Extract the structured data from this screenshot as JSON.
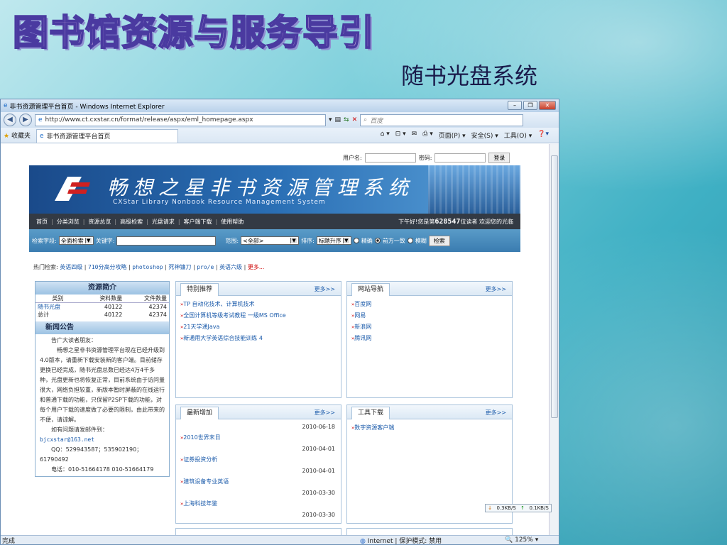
{
  "slide": {
    "title": "图书馆资源与服务导引",
    "subtitle": "随书光盘系统"
  },
  "browser": {
    "window_title": "非书资源管理平台首页 - Windows Internet Explorer",
    "url": "http://www.ct.cxstar.cn/format/release/aspx/eml_homepage.aspx",
    "search_placeholder": "百度",
    "favorites_label": "收藏夹",
    "tab_title": "非书资源管理平台首页",
    "tools": {
      "page": "页面(P) ▾",
      "safety": "安全(S) ▾",
      "tools": "工具(O) ▾"
    },
    "status_left": "完成",
    "status_zone": "Internet | 保护模式: 禁用",
    "zoom": "125%"
  },
  "page": {
    "login": {
      "user_label": "用户名:",
      "pass_label": "密码:",
      "button": "登录"
    },
    "banner": {
      "cn": "畅想之星非书资源管理系统",
      "en": "CXStar Library Nonbook Resource Management System"
    },
    "nav": [
      "首页",
      "分类浏览",
      "资源总览",
      "高级检索",
      "光盘请求",
      "客户端下载",
      "使用帮助"
    ],
    "greeting": {
      "prefix": "下午好!您是第",
      "count": "628547",
      "suffix": "位读者  欢迎您的光临"
    },
    "search": {
      "field_label": "检索字段:",
      "field_value": "全面检索",
      "keyword_label": "关键字:",
      "scope_label": "范围:",
      "scope_value": "<全部>",
      "sort_label": "排序:",
      "sort_value": "标题升序",
      "modes": [
        "精确",
        "前方一致",
        "模糊"
      ],
      "button": "检索"
    },
    "hot": {
      "label": "热门检索:",
      "items": [
        "英语四级",
        "710分高分攻略",
        "photoshop",
        "死神镰刀",
        "pro/e",
        "英语六级"
      ],
      "more": "更多..."
    },
    "resources": {
      "title": "资源简介",
      "headers": [
        "类别",
        "资料数量",
        "文件数量"
      ],
      "rows": [
        [
          "随书光盘",
          "40122",
          "42374"
        ],
        [
          "总计",
          "40122",
          "42374"
        ]
      ]
    },
    "news": {
      "title": "新闻公告",
      "greeting": "告广大读者朋友：",
      "body": "畅想之星非书资源管理平台现在已经升级到4.0版本，请重新下载安装新的客户端。目前储存更换已经完成，随书光盘总数已经达4万4千多种，光盘更新也将恢复正常，目前系统由于访问量很大，网络负担较重，新版本暂时屏蔽的在线运行和普通下载的功能，只保留P2SP下载的功能，对每个用户下载的速度做了必要的限制，由此带来的不便，请谅解。",
      "contact": "如有问题请发邮件到：",
      "email": "bjcxstar@163.net",
      "qq": "QQ：529943587；535902190；61790492",
      "phone": "电话：010-51664178   010-51664179"
    },
    "boxes": {
      "featured": {
        "title": "特别推荐",
        "more": "更多>>",
        "items": [
          "TP 自动化技术、计算机技术",
          "全国计算机等级考试教程 一级MS Office",
          "21天学通Java",
          "新通用大学英语综合技能训练 4"
        ]
      },
      "sites": {
        "title": "网站导航",
        "more": "更多>>",
        "items": [
          "百度网",
          "网易",
          "新浪网",
          "腾讯网"
        ]
      },
      "latest": {
        "title": "最新增加",
        "more": "更多>>",
        "items": [
          {
            "date": "2010-06-18",
            "t": "2010世界末日"
          },
          {
            "date": "2010-04-01",
            "t": "证券投资分析"
          },
          {
            "date": "2010-04-01",
            "t": "建筑设备专业英语"
          },
          {
            "date": "2010-03-30",
            "t": "上海科技年鉴"
          }
        ],
        "last_date": "2010-03-30"
      },
      "tools": {
        "title": "工具下载",
        "more": "更多>>",
        "items": [
          "数字资源客户端"
        ]
      }
    },
    "speed": {
      "down": "0.3KB/S",
      "up": "0.1KB/S"
    }
  }
}
